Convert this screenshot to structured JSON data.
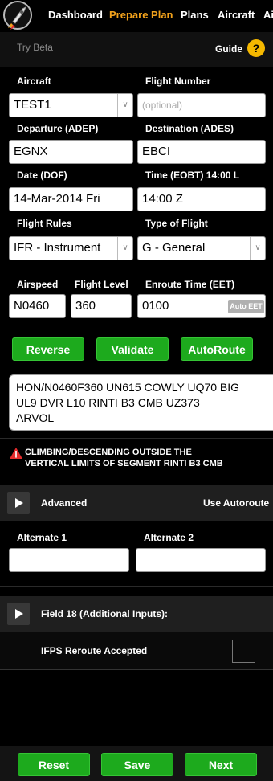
{
  "nav": {
    "items": [
      "Dashboard",
      "Prepare Plan",
      "Plans",
      "Aircraft",
      "Ai"
    ]
  },
  "subheader": {
    "try_beta": "Try Beta",
    "guide": "Guide",
    "help_symbol": "?"
  },
  "form": {
    "aircraft": {
      "label": "Aircraft",
      "value": "TEST1"
    },
    "flight_number": {
      "label": "Flight Number",
      "placeholder": "(optional)"
    },
    "departure": {
      "label": "Departure (ADEP)",
      "value": "EGNX"
    },
    "destination": {
      "label": "Destination (ADES)",
      "value": "EBCI"
    },
    "date": {
      "label": "Date (DOF)",
      "value": "14-Mar-2014 Fri"
    },
    "time": {
      "label": "Time (EOBT) 14:00 L",
      "value": "14:00 Z"
    },
    "flight_rules": {
      "label": "Flight Rules",
      "value": "IFR - Instrument"
    },
    "type_of_flight": {
      "label": "Type of Flight",
      "value": "G - General"
    },
    "airspeed": {
      "label": "Airspeed",
      "value": "N0460"
    },
    "flight_level": {
      "label": "Flight Level",
      "value": "360"
    },
    "enroute_time": {
      "label": "Enroute Time (EET)",
      "value": "0100",
      "auto_label": "Auto EET"
    }
  },
  "actions": {
    "reverse": "Reverse",
    "validate": "Validate",
    "autoroute": "AutoRoute"
  },
  "route": {
    "lines": [
      "HON/N0460F360 UN615 COWLY UQ70 BIG",
      "UL9 DVR L10 RINTI B3 CMB UZ373",
      "ARVOL"
    ]
  },
  "warning": {
    "line1": "CLIMBING/DESCENDING OUTSIDE THE",
    "line2": "VERTICAL LIMITS OF SEGMENT RINTI B3 CMB",
    "color": "#e52b2b"
  },
  "advanced": {
    "label": "Advanced",
    "use_autoroute": "Use Autoroute"
  },
  "alternates": {
    "alt1": "Alternate 1",
    "alt2": "Alternate 2"
  },
  "field18": {
    "label": "Field 18 (Additional Inputs):"
  },
  "ifps": {
    "label": "IFPS Reroute Accepted",
    "checked": false
  },
  "footer": {
    "reset": "Reset",
    "save": "Save",
    "next": "Next"
  },
  "colors": {
    "accent": "#f2a21c",
    "green": "#1daa1d",
    "help": "#f5b800"
  }
}
